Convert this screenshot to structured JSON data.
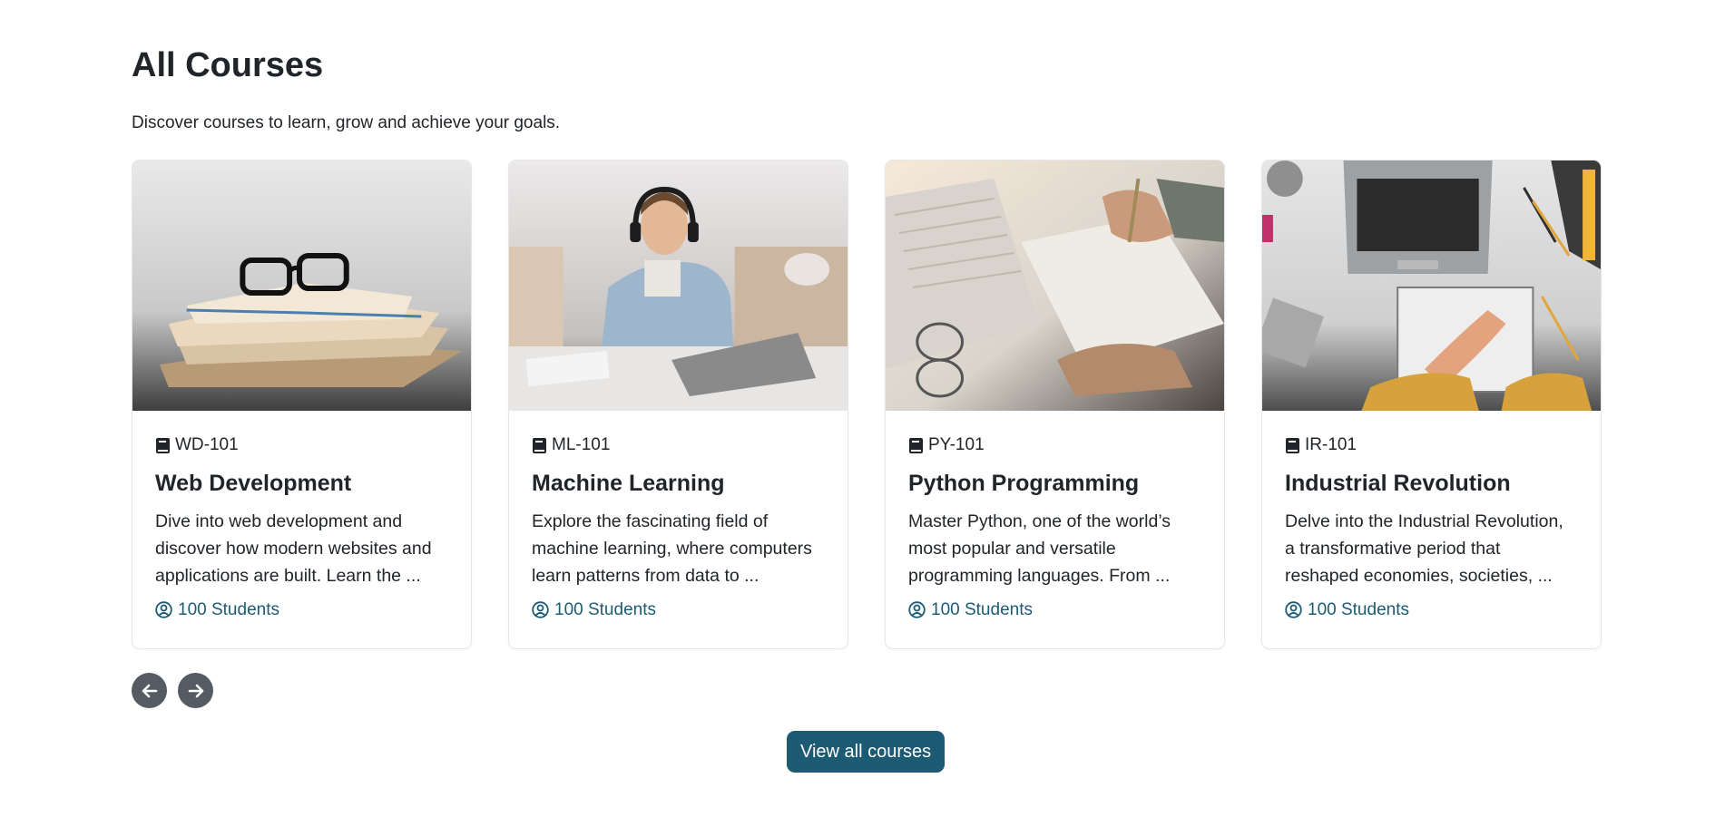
{
  "section": {
    "title": "All Courses",
    "subtitle": "Discover courses to learn, grow and achieve your goals."
  },
  "courses": [
    {
      "code": "WD-101",
      "title": "Web Development",
      "description": "Dive into web development and discover how modern websites and applications are built. Learn the ...",
      "students": "100 Students",
      "image": "books-and-glasses"
    },
    {
      "code": "ML-101",
      "title": "Machine Learning",
      "description": "Explore the fascinating field of machine learning, where computers learn patterns from data to ...",
      "students": "100 Students",
      "image": "man-with-headphones-at-laptop"
    },
    {
      "code": "PY-101",
      "title": "Python Programming",
      "description": "Master Python, one of the world’s most popular and versatile programming languages. From ...",
      "students": "100 Students",
      "image": "hands-writing-with-keyboard"
    },
    {
      "code": "IR-101",
      "title": "Industrial Revolution",
      "description": "Delve into the Industrial Revolution, a transformative period that reshaped economies, societies, ...",
      "students": "100 Students",
      "image": "laptop-and-notebook-desk"
    }
  ],
  "navigation": {
    "prev_icon": "arrow-left-icon",
    "next_icon": "arrow-right-icon"
  },
  "cta": {
    "label": "View all courses"
  },
  "colors": {
    "accent": "#1c5b73",
    "nav_button": "#545b62",
    "text": "#212529"
  }
}
